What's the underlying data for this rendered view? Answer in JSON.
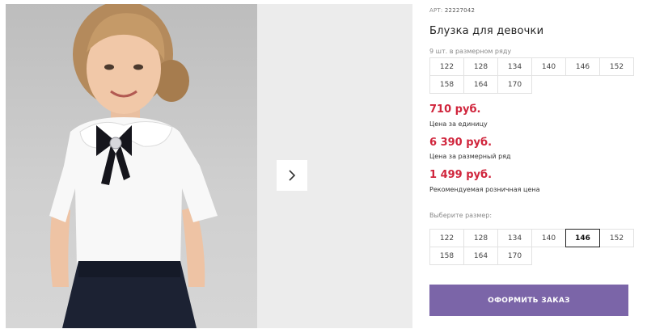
{
  "product": {
    "article_label": "АРТ:",
    "article_number": "22227042",
    "title": "Блузка для девочки",
    "sizes_hint": "9 шт. в размерном ряду",
    "size_row": [
      "122",
      "128",
      "134",
      "140",
      "146",
      "152",
      "158",
      "164",
      "170"
    ]
  },
  "prices": [
    {
      "value": "710 руб.",
      "label": "Цена за единицу"
    },
    {
      "value": "6 390 руб.",
      "label": "Цена за размерный ряд"
    },
    {
      "value": "1 499 руб.",
      "label": "Рекомендуемая розничная цена"
    }
  ],
  "size_select": {
    "label": "Выберите размер:",
    "options": [
      "122",
      "128",
      "134",
      "140",
      "146",
      "152",
      "158",
      "164",
      "170"
    ],
    "selected": "146"
  },
  "order_button": "ОФОРМИТЬ ЗАКАЗ",
  "colors": {
    "price": "#d0253c",
    "button": "#7b65a8"
  },
  "icons": {
    "gallery_next": "chevron-right-icon"
  }
}
